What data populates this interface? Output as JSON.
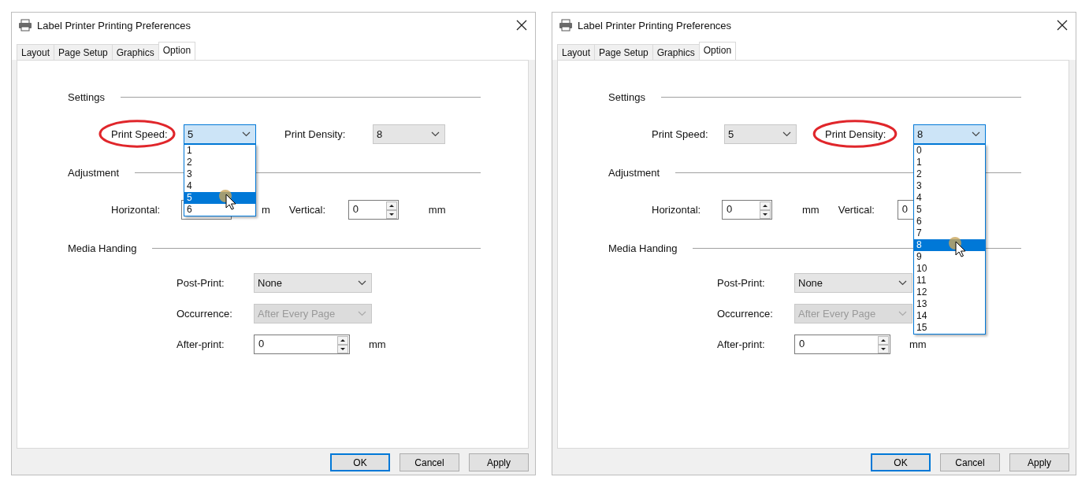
{
  "dialogs": [
    {
      "title": "Label Printer Printing Preferences",
      "tabs": [
        {
          "label": "Layout",
          "selected": false
        },
        {
          "label": "Page Setup",
          "selected": false
        },
        {
          "label": "Graphics",
          "selected": false
        },
        {
          "label": "Option",
          "selected": true
        }
      ],
      "sections": [
        {
          "heading": "Settings",
          "kind": "pairs",
          "rows": [
            [
              {
                "label": "Print Speed:",
                "kind": "combo",
                "value": "5",
                "circled": true,
                "open": true,
                "options": [
                  {
                    "label": "1",
                    "selected": false,
                    "hovered": false
                  },
                  {
                    "label": "2",
                    "selected": false,
                    "hovered": false
                  },
                  {
                    "label": "3",
                    "selected": false,
                    "hovered": false
                  },
                  {
                    "label": "4",
                    "selected": false,
                    "hovered": false
                  },
                  {
                    "label": "5",
                    "selected": true,
                    "hovered": true
                  },
                  {
                    "label": "6",
                    "selected": false,
                    "hovered": false
                  }
                ]
              },
              {
                "label": "Print Density:",
                "kind": "combo",
                "value": "8"
              }
            ]
          ]
        },
        {
          "heading": "Adjustment",
          "kind": "pairs",
          "rows": [
            [
              {
                "label": "Horizontal:",
                "kind": "spin",
                "unit": "m"
              },
              {
                "label": "Vertical:",
                "kind": "spin",
                "value": "0",
                "unit": "mm"
              }
            ]
          ]
        },
        {
          "heading": "Media Handing",
          "kind": "stack",
          "rows": [
            [
              {
                "label": "Post-Print:",
                "kind": "combo",
                "value": "None",
                "disabled": false
              }
            ],
            [
              {
                "label": "Occurrence:",
                "kind": "combo",
                "value": "After Every Page",
                "disabled": true
              }
            ],
            [
              {
                "label": "After-print:",
                "kind": "spin",
                "value": "0",
                "unit": "mm"
              }
            ]
          ]
        }
      ],
      "buttons": [
        {
          "label": "OK",
          "default": true
        },
        {
          "label": "Cancel",
          "default": false
        },
        {
          "label": "Apply",
          "default": false
        }
      ]
    },
    {
      "title": "Label Printer Printing Preferences",
      "tabs": [
        {
          "label": "Layout",
          "selected": false
        },
        {
          "label": "Page Setup",
          "selected": false
        },
        {
          "label": "Graphics",
          "selected": false
        },
        {
          "label": "Option",
          "selected": true
        }
      ],
      "sections": [
        {
          "heading": "Settings",
          "kind": "pairs",
          "rows": [
            [
              {
                "label": "Print Speed:",
                "kind": "combo",
                "value": "5"
              },
              {
                "label": "Print Density:",
                "kind": "combo",
                "value": "8",
                "circled": true,
                "open": true,
                "options": [
                  {
                    "label": "0",
                    "selected": false,
                    "hovered": false
                  },
                  {
                    "label": "1",
                    "selected": false,
                    "hovered": false
                  },
                  {
                    "label": "2",
                    "selected": false,
                    "hovered": false
                  },
                  {
                    "label": "3",
                    "selected": false,
                    "hovered": false
                  },
                  {
                    "label": "4",
                    "selected": false,
                    "hovered": false
                  },
                  {
                    "label": "5",
                    "selected": false,
                    "hovered": false
                  },
                  {
                    "label": "6",
                    "selected": false,
                    "hovered": false
                  },
                  {
                    "label": "7",
                    "selected": false,
                    "hovered": false
                  },
                  {
                    "label": "8",
                    "selected": true,
                    "hovered": true
                  },
                  {
                    "label": "9",
                    "selected": false,
                    "hovered": false
                  },
                  {
                    "label": "10",
                    "selected": false,
                    "hovered": false
                  },
                  {
                    "label": "11",
                    "selected": false,
                    "hovered": false
                  },
                  {
                    "label": "12",
                    "selected": false,
                    "hovered": false
                  },
                  {
                    "label": "13",
                    "selected": false,
                    "hovered": false
                  },
                  {
                    "label": "14",
                    "selected": false,
                    "hovered": false
                  },
                  {
                    "label": "15",
                    "selected": false,
                    "hovered": false
                  }
                ]
              }
            ]
          ]
        },
        {
          "heading": "Adjustment",
          "kind": "pairs",
          "rows": [
            [
              {
                "label": "Horizontal:",
                "kind": "spin",
                "value": "0",
                "unit": "mm"
              },
              {
                "label": "Vertical:",
                "kind": "spin",
                "value": "0"
              }
            ]
          ]
        },
        {
          "heading": "Media Handing",
          "kind": "stack",
          "rows": [
            [
              {
                "label": "Post-Print:",
                "kind": "combo",
                "value": "None",
                "disabled": false
              }
            ],
            [
              {
                "label": "Occurrence:",
                "kind": "combo",
                "value": "After Every Page",
                "disabled": true
              }
            ],
            [
              {
                "label": "After-print:",
                "kind": "spin",
                "value": "0",
                "unit": "mm"
              }
            ]
          ]
        }
      ],
      "buttons": [
        {
          "label": "OK",
          "default": true
        },
        {
          "label": "Cancel",
          "default": false
        },
        {
          "label": "Apply",
          "default": false
        }
      ]
    }
  ]
}
